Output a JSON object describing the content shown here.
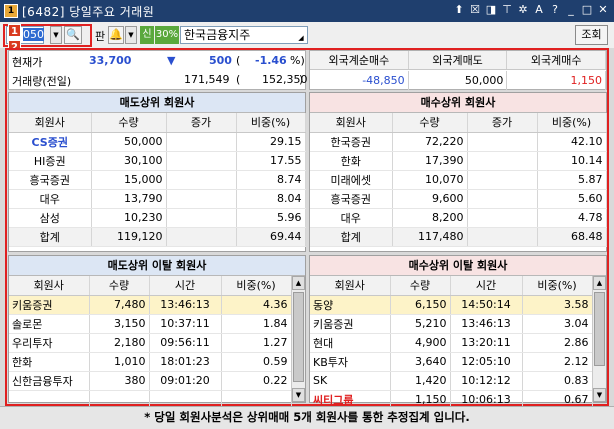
{
  "window": {
    "title": "[6482] 당일주요 거래원",
    "buttons": [
      "⬆",
      "☒",
      "◨",
      "⊤",
      "✲",
      "A",
      "?",
      "_",
      "□",
      "✕"
    ]
  },
  "toolbar": {
    "badge1": "1",
    "badge2": "2",
    "stock_code": "050",
    "code_prefix": "10",
    "pan_label": "판",
    "shin_label": "신",
    "percent_label": "30%",
    "stock_name": "한국금융지주",
    "inquiry_button": "조회"
  },
  "quote": {
    "current_label": "현재가",
    "current_price": "33,700",
    "change_arrow": "▼",
    "change_value": "500",
    "change_rate": "-1.46",
    "volume_label": "거래량(전일)",
    "volume": "171,549",
    "prev_volume": "152,350"
  },
  "foreign": {
    "headers": [
      "외국계순매수",
      "외국계매도",
      "외국계매수"
    ],
    "values": [
      "-48,850",
      "50,000",
      "1,150"
    ]
  },
  "sell_top": {
    "title": "매도상위 회원사",
    "headers": [
      "회원사",
      "수량",
      "증가",
      "비중(%)"
    ],
    "rows": [
      {
        "name": "CS증권",
        "qty": "50,000",
        "inc": "",
        "pct": "29.15"
      },
      {
        "name": "HI증권",
        "qty": "30,100",
        "inc": "",
        "pct": "17.55"
      },
      {
        "name": "흥국증권",
        "qty": "15,000",
        "inc": "",
        "pct": "8.74"
      },
      {
        "name": "대우",
        "qty": "13,790",
        "inc": "",
        "pct": "8.04"
      },
      {
        "name": "삼성",
        "qty": "10,230",
        "inc": "",
        "pct": "5.96"
      },
      {
        "name": "합계",
        "qty": "119,120",
        "inc": "",
        "pct": "69.44"
      }
    ]
  },
  "buy_top": {
    "title": "매수상위 회원사",
    "headers": [
      "회원사",
      "수량",
      "증가",
      "비중(%)"
    ],
    "rows": [
      {
        "name": "한국증권",
        "qty": "72,220",
        "inc": "",
        "pct": "42.10"
      },
      {
        "name": "한화",
        "qty": "17,390",
        "inc": "",
        "pct": "10.14"
      },
      {
        "name": "미래에셋",
        "qty": "10,070",
        "inc": "",
        "pct": "5.87"
      },
      {
        "name": "흥국증권",
        "qty": "9,600",
        "inc": "",
        "pct": "5.60"
      },
      {
        "name": "대우",
        "qty": "8,200",
        "inc": "",
        "pct": "4.78"
      },
      {
        "name": "합계",
        "qty": "117,480",
        "inc": "",
        "pct": "68.48"
      }
    ]
  },
  "sell_exit": {
    "title": "매도상위 이탈 회원사",
    "headers": [
      "회원사",
      "수량",
      "시간",
      "비중(%)"
    ],
    "rows": [
      {
        "name": "키움증권",
        "qty": "7,480",
        "time": "13:46:13",
        "pct": "4.36"
      },
      {
        "name": "솔로몬",
        "qty": "3,150",
        "time": "10:37:11",
        "pct": "1.84"
      },
      {
        "name": "우리투자",
        "qty": "2,180",
        "time": "09:56:11",
        "pct": "1.27"
      },
      {
        "name": "한화",
        "qty": "1,010",
        "time": "18:01:23",
        "pct": "0.59"
      },
      {
        "name": "신한금융투자",
        "qty": "380",
        "time": "09:01:20",
        "pct": "0.22"
      },
      {
        "name": "",
        "qty": "",
        "time": "",
        "pct": ""
      }
    ]
  },
  "buy_exit": {
    "title": "매수상위 이탈 회원사",
    "headers": [
      "회원사",
      "수량",
      "시간",
      "비중(%)"
    ],
    "rows": [
      {
        "name": "동양",
        "qty": "6,150",
        "time": "14:50:14",
        "pct": "3.58"
      },
      {
        "name": "키움증권",
        "qty": "5,210",
        "time": "13:46:13",
        "pct": "3.04"
      },
      {
        "name": "현대",
        "qty": "4,900",
        "time": "13:20:11",
        "pct": "2.86"
      },
      {
        "name": "KB투자",
        "qty": "3,640",
        "time": "12:05:10",
        "pct": "2.12"
      },
      {
        "name": "SK",
        "qty": "1,420",
        "time": "10:12:12",
        "pct": "0.83"
      },
      {
        "name": "씨티그룹",
        "qty": "1,150",
        "time": "10:06:13",
        "pct": "0.67"
      }
    ]
  },
  "note": "* 당일 회원사분석은 상위매매 5개 회원사를 통한 추정집계 입니다.",
  "colors": {
    "titlebar": "#1f3f6e",
    "highlight_frame": "#e02020",
    "blue_panel": "#dce6f4",
    "pink_panel": "#f8e3e3",
    "down_blue": "#2a4fcf",
    "up_red": "#e02020"
  }
}
